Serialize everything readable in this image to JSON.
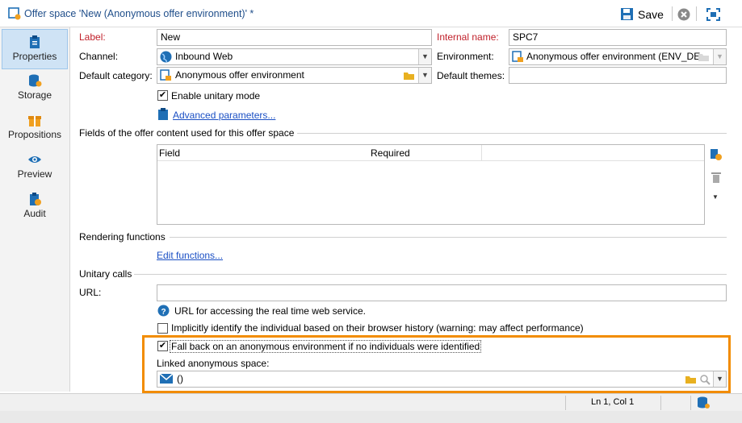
{
  "title": "Offer space 'New (Anonymous offer environment)' *",
  "toolbar": {
    "save_label": "Save"
  },
  "sidebar": {
    "items": [
      {
        "label": "Properties"
      },
      {
        "label": "Storage"
      },
      {
        "label": "Propositions"
      },
      {
        "label": "Preview"
      },
      {
        "label": "Audit"
      }
    ]
  },
  "form": {
    "label_caption": "Label:",
    "label_value": "New",
    "internal_name_caption": "Internal name:",
    "internal_name_value": "SPC7",
    "channel_caption": "Channel:",
    "channel_value": "Inbound Web",
    "environment_caption": "Environment:",
    "environment_value": "Anonymous offer environment (ENV_DE",
    "default_category_caption": "Default category:",
    "default_category_value": "Anonymous offer environment",
    "default_themes_caption": "Default themes:",
    "default_themes_value": "",
    "enable_unitary_label": "Enable unitary mode",
    "advanced_link": "Advanced parameters...",
    "fields_section": "Fields of the offer content used for this offer space",
    "table_headers": [
      "Field",
      "Required"
    ],
    "rendering_section": "Rendering functions",
    "edit_functions_link": "Edit functions...",
    "unitary_section": "Unitary calls",
    "url_caption": "URL:",
    "url_value": "",
    "url_help": "URL for accessing the real time web service.",
    "implicit_label": "Implicitly identify the individual based on their browser history (warning: may affect performance)",
    "fallback_label": "Fall back on an anonymous environment if no individuals were identified",
    "linked_caption": "Linked anonymous space:",
    "linked_value": "()"
  },
  "status": {
    "position": "Ln 1, Col 1"
  },
  "colors": {
    "highlight": "#f28c00",
    "link": "#1a4fc4",
    "required": "#c0202a"
  }
}
